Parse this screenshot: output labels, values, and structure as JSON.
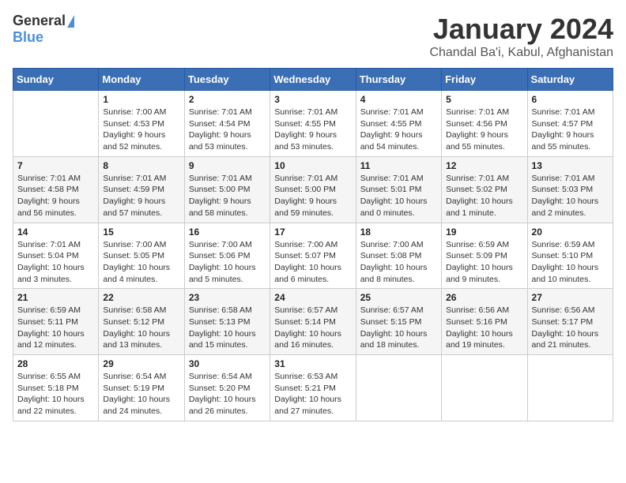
{
  "header": {
    "logo_general": "General",
    "logo_blue": "Blue",
    "title": "January 2024",
    "subtitle": "Chandal Ba'i, Kabul, Afghanistan"
  },
  "calendar": {
    "days_of_week": [
      "Sunday",
      "Monday",
      "Tuesday",
      "Wednesday",
      "Thursday",
      "Friday",
      "Saturday"
    ],
    "weeks": [
      [
        {
          "day": "",
          "detail": ""
        },
        {
          "day": "1",
          "detail": "Sunrise: 7:00 AM\nSunset: 4:53 PM\nDaylight: 9 hours\nand 52 minutes."
        },
        {
          "day": "2",
          "detail": "Sunrise: 7:01 AM\nSunset: 4:54 PM\nDaylight: 9 hours\nand 53 minutes."
        },
        {
          "day": "3",
          "detail": "Sunrise: 7:01 AM\nSunset: 4:55 PM\nDaylight: 9 hours\nand 53 minutes."
        },
        {
          "day": "4",
          "detail": "Sunrise: 7:01 AM\nSunset: 4:55 PM\nDaylight: 9 hours\nand 54 minutes."
        },
        {
          "day": "5",
          "detail": "Sunrise: 7:01 AM\nSunset: 4:56 PM\nDaylight: 9 hours\nand 55 minutes."
        },
        {
          "day": "6",
          "detail": "Sunrise: 7:01 AM\nSunset: 4:57 PM\nDaylight: 9 hours\nand 55 minutes."
        }
      ],
      [
        {
          "day": "7",
          "detail": "Sunrise: 7:01 AM\nSunset: 4:58 PM\nDaylight: 9 hours\nand 56 minutes."
        },
        {
          "day": "8",
          "detail": "Sunrise: 7:01 AM\nSunset: 4:59 PM\nDaylight: 9 hours\nand 57 minutes."
        },
        {
          "day": "9",
          "detail": "Sunrise: 7:01 AM\nSunset: 5:00 PM\nDaylight: 9 hours\nand 58 minutes."
        },
        {
          "day": "10",
          "detail": "Sunrise: 7:01 AM\nSunset: 5:00 PM\nDaylight: 9 hours\nand 59 minutes."
        },
        {
          "day": "11",
          "detail": "Sunrise: 7:01 AM\nSunset: 5:01 PM\nDaylight: 10 hours\nand 0 minutes."
        },
        {
          "day": "12",
          "detail": "Sunrise: 7:01 AM\nSunset: 5:02 PM\nDaylight: 10 hours\nand 1 minute."
        },
        {
          "day": "13",
          "detail": "Sunrise: 7:01 AM\nSunset: 5:03 PM\nDaylight: 10 hours\nand 2 minutes."
        }
      ],
      [
        {
          "day": "14",
          "detail": "Sunrise: 7:01 AM\nSunset: 5:04 PM\nDaylight: 10 hours\nand 3 minutes."
        },
        {
          "day": "15",
          "detail": "Sunrise: 7:00 AM\nSunset: 5:05 PM\nDaylight: 10 hours\nand 4 minutes."
        },
        {
          "day": "16",
          "detail": "Sunrise: 7:00 AM\nSunset: 5:06 PM\nDaylight: 10 hours\nand 5 minutes."
        },
        {
          "day": "17",
          "detail": "Sunrise: 7:00 AM\nSunset: 5:07 PM\nDaylight: 10 hours\nand 6 minutes."
        },
        {
          "day": "18",
          "detail": "Sunrise: 7:00 AM\nSunset: 5:08 PM\nDaylight: 10 hours\nand 8 minutes."
        },
        {
          "day": "19",
          "detail": "Sunrise: 6:59 AM\nSunset: 5:09 PM\nDaylight: 10 hours\nand 9 minutes."
        },
        {
          "day": "20",
          "detail": "Sunrise: 6:59 AM\nSunset: 5:10 PM\nDaylight: 10 hours\nand 10 minutes."
        }
      ],
      [
        {
          "day": "21",
          "detail": "Sunrise: 6:59 AM\nSunset: 5:11 PM\nDaylight: 10 hours\nand 12 minutes."
        },
        {
          "day": "22",
          "detail": "Sunrise: 6:58 AM\nSunset: 5:12 PM\nDaylight: 10 hours\nand 13 minutes."
        },
        {
          "day": "23",
          "detail": "Sunrise: 6:58 AM\nSunset: 5:13 PM\nDaylight: 10 hours\nand 15 minutes."
        },
        {
          "day": "24",
          "detail": "Sunrise: 6:57 AM\nSunset: 5:14 PM\nDaylight: 10 hours\nand 16 minutes."
        },
        {
          "day": "25",
          "detail": "Sunrise: 6:57 AM\nSunset: 5:15 PM\nDaylight: 10 hours\nand 18 minutes."
        },
        {
          "day": "26",
          "detail": "Sunrise: 6:56 AM\nSunset: 5:16 PM\nDaylight: 10 hours\nand 19 minutes."
        },
        {
          "day": "27",
          "detail": "Sunrise: 6:56 AM\nSunset: 5:17 PM\nDaylight: 10 hours\nand 21 minutes."
        }
      ],
      [
        {
          "day": "28",
          "detail": "Sunrise: 6:55 AM\nSunset: 5:18 PM\nDaylight: 10 hours\nand 22 minutes."
        },
        {
          "day": "29",
          "detail": "Sunrise: 6:54 AM\nSunset: 5:19 PM\nDaylight: 10 hours\nand 24 minutes."
        },
        {
          "day": "30",
          "detail": "Sunrise: 6:54 AM\nSunset: 5:20 PM\nDaylight: 10 hours\nand 26 minutes."
        },
        {
          "day": "31",
          "detail": "Sunrise: 6:53 AM\nSunset: 5:21 PM\nDaylight: 10 hours\nand 27 minutes."
        },
        {
          "day": "",
          "detail": ""
        },
        {
          "day": "",
          "detail": ""
        },
        {
          "day": "",
          "detail": ""
        }
      ]
    ]
  }
}
